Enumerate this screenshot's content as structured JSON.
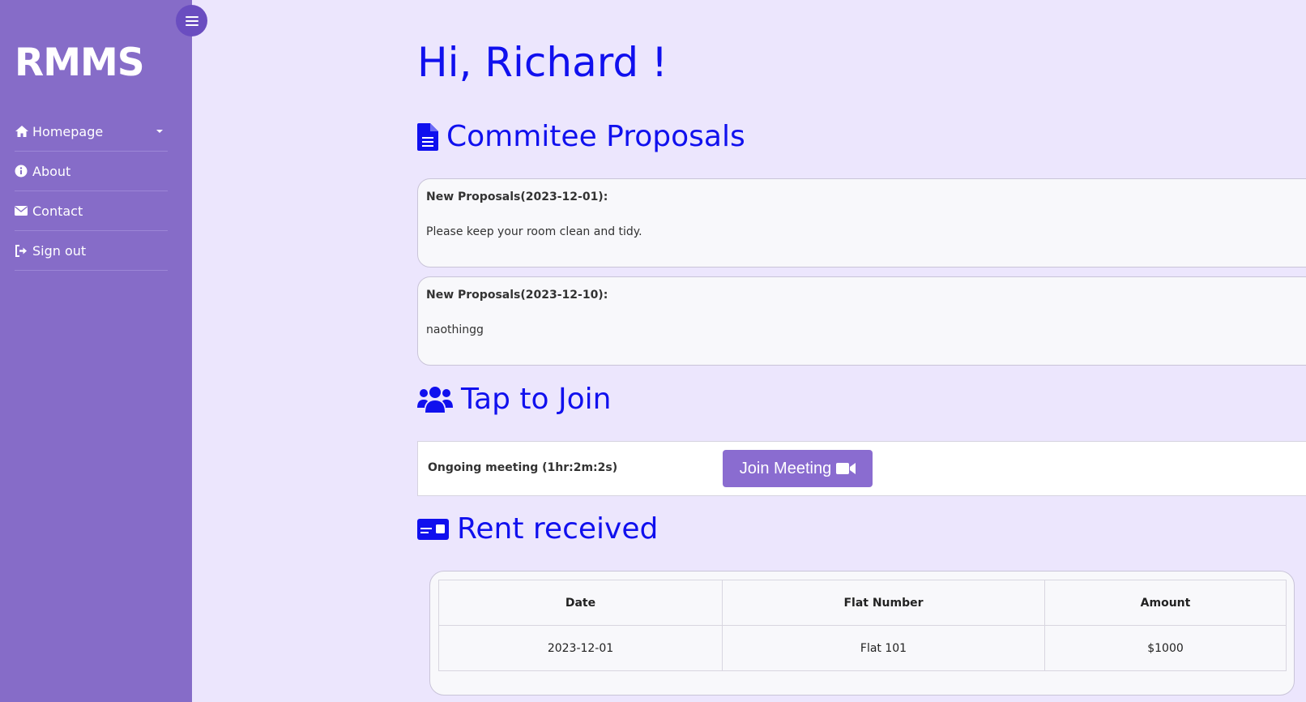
{
  "sidebar": {
    "brand": "RMMS",
    "items": [
      {
        "label": "Homepage",
        "icon": "home-icon"
      },
      {
        "label": "About",
        "icon": "info-icon"
      },
      {
        "label": "Contact",
        "icon": "envelope-icon"
      },
      {
        "label": "Sign out",
        "icon": "sign-out-icon"
      }
    ]
  },
  "main": {
    "greeting": "Hi, Richard !",
    "proposals": {
      "title": "Commitee Proposals",
      "items": [
        {
          "title": "New Proposals(2023-12-01):",
          "body": "Please keep your room clean and tidy."
        },
        {
          "title": "New Proposals(2023-12-10):",
          "body": "naothingg"
        }
      ]
    },
    "join": {
      "title": "Tap to Join",
      "status": "Ongoing meeting (1hr:2m:2s)",
      "button": "Join Meeting"
    },
    "rent": {
      "title": "Rent received",
      "columns": [
        "Date",
        "Flat Number",
        "Amount"
      ],
      "rows": [
        [
          "2023-12-01",
          "Flat 101",
          "$1000"
        ]
      ]
    }
  },
  "colors": {
    "sidebar": "#866cc8",
    "background": "#ece6fd",
    "accent_text": "#1010ee",
    "button": "#8a6cd0"
  }
}
